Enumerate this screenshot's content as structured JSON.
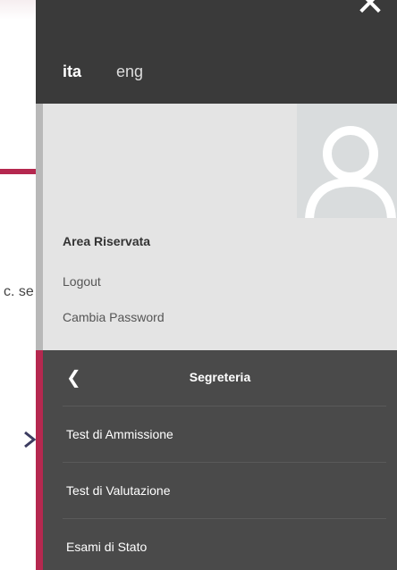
{
  "background": {
    "partial_text": "c. se"
  },
  "drawer": {
    "close_icon": "close-icon",
    "languages": {
      "ita": "ita",
      "eng": "eng"
    },
    "user_panel": {
      "title": "Area Riservata",
      "logout": "Logout",
      "change_password": "Cambia Password"
    },
    "menu": {
      "title": "Segreteria",
      "items": [
        {
          "label": "Test di Ammissione"
        },
        {
          "label": "Test di Valutazione"
        },
        {
          "label": "Esami di Stato"
        }
      ]
    }
  },
  "colors": {
    "accent": "#b5284f",
    "drawer_bg": "#3a3a3a",
    "menu_bg": "#4a4a4a",
    "panel_bg": "#e4e4e4"
  }
}
